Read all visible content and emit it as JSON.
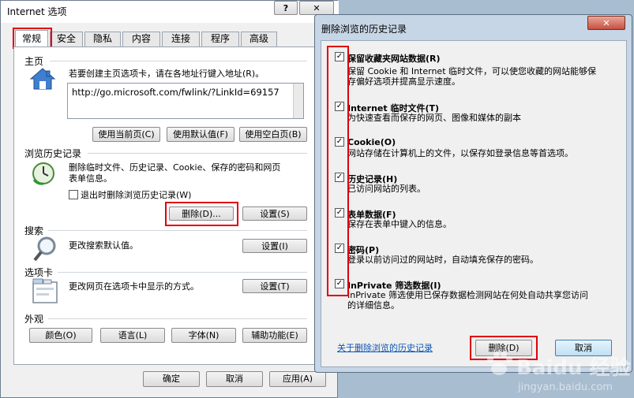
{
  "ie_options": {
    "title": "Internet 选项",
    "help_label": "?",
    "close_label": "✕",
    "tabs": [
      "常规",
      "安全",
      "隐私",
      "内容",
      "连接",
      "程序",
      "高级"
    ],
    "homepage": {
      "section": "主页",
      "hint": "若要创建主页选项卡，请在各地址行键入地址(R)。",
      "url": "http://go.microsoft.com/fwlink/?LinkId=69157",
      "btn_current": "使用当前页(C)",
      "btn_default": "使用默认值(F)",
      "btn_blank": "使用空白页(B)"
    },
    "history": {
      "section": "浏览历史记录",
      "desc_line1": "删除临时文件、历史记录、Cookie、保存的密码和网页",
      "desc_line2": "表单信息。",
      "checkbox_label": "退出时删除浏览历史记录(W)",
      "btn_delete": "删除(D)...",
      "btn_settings": "设置(S)"
    },
    "search": {
      "section": "搜索",
      "desc": "更改搜索默认值。",
      "btn_settings": "设置(I)"
    },
    "tabs_section": {
      "section": "选项卡",
      "desc": "更改网页在选项卡中显示的方式。",
      "btn_settings": "设置(T)"
    },
    "appearance": {
      "section": "外观",
      "btn_colors": "颜色(O)",
      "btn_languages": "语言(L)",
      "btn_fonts": "字体(N)",
      "btn_accessibility": "辅助功能(E)"
    },
    "footer": {
      "ok": "确定",
      "cancel": "取消",
      "apply": "应用(A)"
    }
  },
  "delete_dialog": {
    "title": "删除浏览的历史记录",
    "close_label": "✕",
    "items": [
      {
        "title": "保留收藏夹网站数据(R)",
        "desc": [
          "保留 Cookie 和 Internet 临时文件，可以使您收藏的网站能够保",
          "存偏好选项并提高显示速度。"
        ],
        "checked": true
      },
      {
        "title": "Internet 临时文件(T)",
        "desc": [
          "为快速查看而保存的网页、图像和媒体的副本"
        ],
        "checked": true
      },
      {
        "title": "Cookie(O)",
        "desc": [
          "网站存储在计算机上的文件，以保存如登录信息等首选项。"
        ],
        "checked": true
      },
      {
        "title": "历史记录(H)",
        "desc": [
          "已访问网站的列表。"
        ],
        "checked": true
      },
      {
        "title": "表单数据(F)",
        "desc": [
          "保存在表单中键入的信息。"
        ],
        "checked": true
      },
      {
        "title": "密码(P)",
        "desc": [
          "登录以前访问过的网站时，自动填充保存的密码。"
        ],
        "checked": true
      },
      {
        "title": "InPrivate 筛选数据(I)",
        "desc": [
          "InPrivate 筛选使用已保存数据检测网站在何处自动共享您访问",
          "的详细信息。"
        ],
        "checked": true
      }
    ],
    "about_link": "关于删除浏览的历史记录",
    "btn_delete": "删除(D)",
    "btn_cancel": "取消"
  },
  "watermark": {
    "brand": "Baidu 经验",
    "url": "jingyan.baidu.com"
  },
  "colors": {
    "highlight_red": "#e0000b",
    "title_bar": "#ffffff",
    "dialog_bg": "#f0f0f0",
    "link_blue": "#0a55b5"
  }
}
